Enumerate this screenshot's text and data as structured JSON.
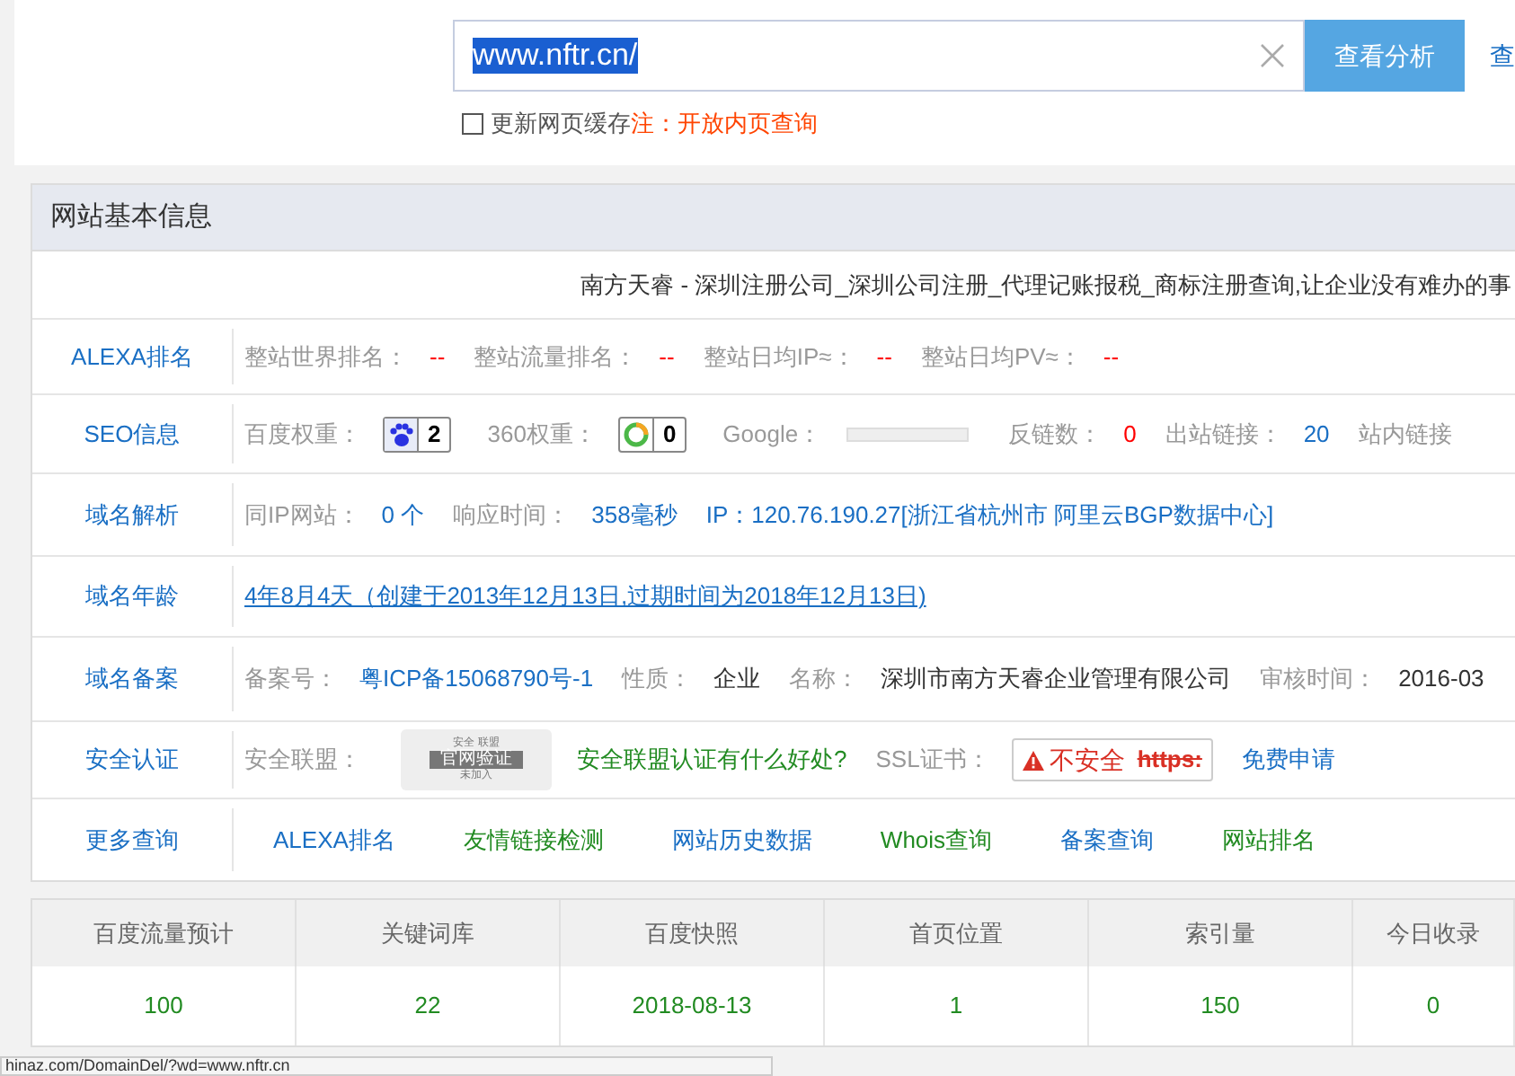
{
  "search": {
    "value": "www.nftr.cn/",
    "button": "查看分析",
    "side_link": "查"
  },
  "cache_option": {
    "label": "更新网页缓存",
    "checked": false,
    "note": "注：开放内页查询"
  },
  "panel": {
    "title": "网站基本信息",
    "site_title": "南方天睿 - 深圳注册公司_深圳公司注册_代理记账报税_商标注册查询,让企业没有难办的事",
    "rows": [
      {
        "label": "ALEXA排名",
        "items": [
          {
            "kind": "field",
            "text": "整站世界排名："
          },
          {
            "kind": "value",
            "text": "--",
            "color": "#ff0000"
          },
          {
            "kind": "field",
            "text": "整站流量排名："
          },
          {
            "kind": "value",
            "text": "--",
            "color": "#ff0000"
          },
          {
            "kind": "field",
            "text": "整站日均IP≈："
          },
          {
            "kind": "value",
            "text": "--",
            "color": "#ff0000"
          },
          {
            "kind": "field",
            "text": "整站日均PV≈："
          },
          {
            "kind": "value",
            "text": "--",
            "color": "#ff0000"
          }
        ]
      },
      {
        "label": "SEO信息",
        "items": [
          {
            "kind": "field",
            "text": "百度权重："
          },
          {
            "kind": "badge",
            "text": "2"
          },
          {
            "kind": "field",
            "text": "360权重："
          },
          {
            "kind": "badge",
            "text": "0"
          },
          {
            "kind": "field",
            "text": "Google："
          },
          {
            "kind": "bar"
          },
          {
            "kind": "field",
            "text": "反链数："
          },
          {
            "kind": "value",
            "text": "0",
            "color": "#ff0000"
          },
          {
            "kind": "field",
            "text": "出站链接："
          },
          {
            "kind": "value",
            "text": "20",
            "color": "#1a6fc4"
          },
          {
            "kind": "field",
            "text": "站内链接"
          }
        ]
      },
      {
        "label": "域名解析",
        "items": [
          {
            "kind": "field",
            "text": "同IP网站："
          },
          {
            "kind": "value",
            "text": "0 个",
            "color": "#1a6fc4"
          },
          {
            "kind": "field",
            "text": "响应时间："
          },
          {
            "kind": "value",
            "text": "358毫秒",
            "color": "#1a6fc4"
          },
          {
            "kind": "value",
            "text": "IP：120.76.190.27[浙江省杭州市 阿里云BGP数据中心]",
            "color": "#1a6fc4"
          }
        ]
      },
      {
        "label": "域名年龄",
        "items": [
          {
            "kind": "link",
            "text": "4年8月4天（创建于2013年12月13日,过期时间为2018年12月13日)",
            "color": "#1a6fc4"
          }
        ]
      },
      {
        "label": "域名备案",
        "items": [
          {
            "kind": "field",
            "text": "备案号："
          },
          {
            "kind": "value",
            "text": "粤ICP备15068790号-1",
            "color": "#1a6fc4"
          },
          {
            "kind": "field",
            "text": "性质："
          },
          {
            "kind": "value",
            "text": "企业",
            "color": "#333333"
          },
          {
            "kind": "field",
            "text": "名称："
          },
          {
            "kind": "value",
            "text": "深圳市南方天睿企业管理有限公司",
            "color": "#333333"
          },
          {
            "kind": "field",
            "text": "审核时间："
          },
          {
            "kind": "value",
            "text": "2016-03",
            "color": "#333333"
          }
        ]
      },
      {
        "label": "安全认证",
        "items": [
          {
            "kind": "field",
            "text": "安全联盟："
          },
          {
            "kind": "seal",
            "top": "安全 联盟",
            "main": "官网验证",
            "bottom": "未加入"
          },
          {
            "kind": "value",
            "text": "安全联盟认证有什么好处?",
            "color": "#228b22"
          },
          {
            "kind": "field",
            "text": "SSL证书："
          },
          {
            "kind": "ssl",
            "text": "不安全",
            "strike": "https:"
          },
          {
            "kind": "value",
            "text": "免费申请",
            "color": "#1a6fc4"
          }
        ]
      },
      {
        "label": "更多查询",
        "items": [
          {
            "kind": "value",
            "text": "ALEXA排名",
            "color": "#1a6fc4"
          },
          {
            "kind": "value",
            "text": "友情链接检测",
            "color": "#228b22"
          },
          {
            "kind": "value",
            "text": "网站历史数据",
            "color": "#1a6fc4"
          },
          {
            "kind": "value",
            "text": "Whois查询",
            "color": "#228b22"
          },
          {
            "kind": "value",
            "text": "备案查询",
            "color": "#1a6fc4"
          },
          {
            "kind": "value",
            "text": "网站排名",
            "color": "#228b22"
          }
        ]
      }
    ]
  },
  "stats": {
    "columns": [
      "百度流量预计",
      "关键词库",
      "百度快照",
      "首页位置",
      "索引量",
      "今日收录"
    ],
    "values": [
      "100",
      "22",
      "2018-08-13",
      "1",
      "150",
      "0"
    ]
  },
  "status_bar": "hinaz.com/DomainDel/?wd=www.nftr.cn"
}
